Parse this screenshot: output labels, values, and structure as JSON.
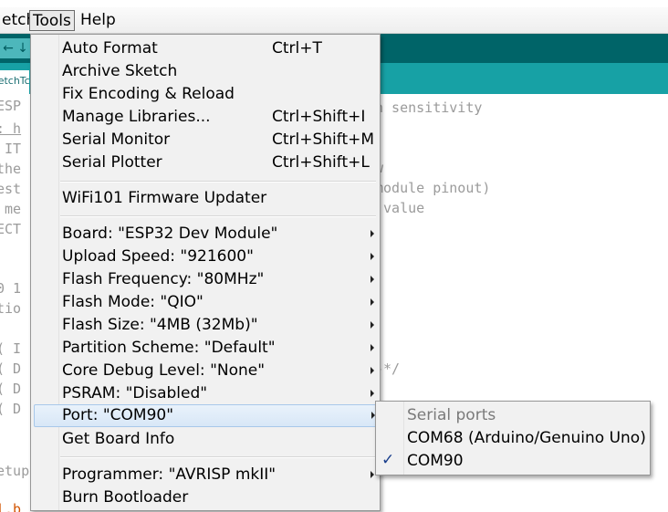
{
  "menubar": {
    "sketch": "etch",
    "tools": "Tools",
    "help": "Help"
  },
  "editor_lines": [
    {
      "text": "ESP"
    },
    {
      "text": ": h",
      "underline": true
    },
    {
      "text": " IT"
    },
    {
      "text": "the"
    },
    {
      "text": "est"
    },
    {
      "text": " me"
    },
    {
      "text": "ECT"
    },
    {
      "text": "0 1"
    },
    {
      "text": "tio"
    },
    {
      "text": "( I"
    },
    {
      "text": "( D"
    },
    {
      "text": "( D"
    },
    {
      "text": "( D"
    },
    {
      "text": "etup"
    },
    {
      "text": "l.b"
    }
  ],
  "editor_right": [
    {
      "text": "n sensitivity"
    },
    {
      "text": "w"
    },
    {
      "text": "module pinout)"
    },
    {
      "text": " value"
    },
    {
      "text": "-*/"
    }
  ],
  "tab_label": "sketchTc",
  "tools_menu": {
    "group1": [
      {
        "label": "Auto Format",
        "shortcut": "Ctrl+T"
      },
      {
        "label": "Archive Sketch",
        "shortcut": ""
      },
      {
        "label": "Fix Encoding & Reload",
        "shortcut": ""
      },
      {
        "label": "Manage Libraries...",
        "shortcut": "Ctrl+Shift+I"
      },
      {
        "label": "Serial Monitor",
        "shortcut": "Ctrl+Shift+M"
      },
      {
        "label": "Serial Plotter",
        "shortcut": "Ctrl+Shift+L"
      }
    ],
    "group2": [
      {
        "label": "WiFi101 Firmware Updater"
      }
    ],
    "group3": [
      {
        "label": "Board: \"ESP32 Dev Module\""
      },
      {
        "label": "Upload Speed: \"921600\""
      },
      {
        "label": "Flash Frequency: \"80MHz\""
      },
      {
        "label": "Flash Mode: \"QIO\""
      },
      {
        "label": "Flash Size: \"4MB (32Mb)\""
      },
      {
        "label": "Partition Scheme: \"Default\""
      },
      {
        "label": "Core Debug Level: \"None\""
      },
      {
        "label": "PSRAM: \"Disabled\""
      },
      {
        "label": "Port: \"COM90\""
      }
    ],
    "get_board_info": "Get Board Info",
    "group4": [
      {
        "label": "Programmer: \"AVRISP mkII\""
      },
      {
        "label": "Burn Bootloader"
      }
    ]
  },
  "port_submenu": {
    "header": "Serial ports",
    "ports": [
      {
        "label": "COM68 (Arduino/Genuino Uno)",
        "checked": false
      },
      {
        "label": "COM90",
        "checked": true
      }
    ],
    "check_glyph": "✓"
  },
  "toolbar": {
    "left_glyph": "←",
    "download_glyph": "↓"
  },
  "colors": {
    "toolbar": "#006468",
    "tabstrip": "#17a1a5",
    "highlight": "#d8e7f7"
  }
}
